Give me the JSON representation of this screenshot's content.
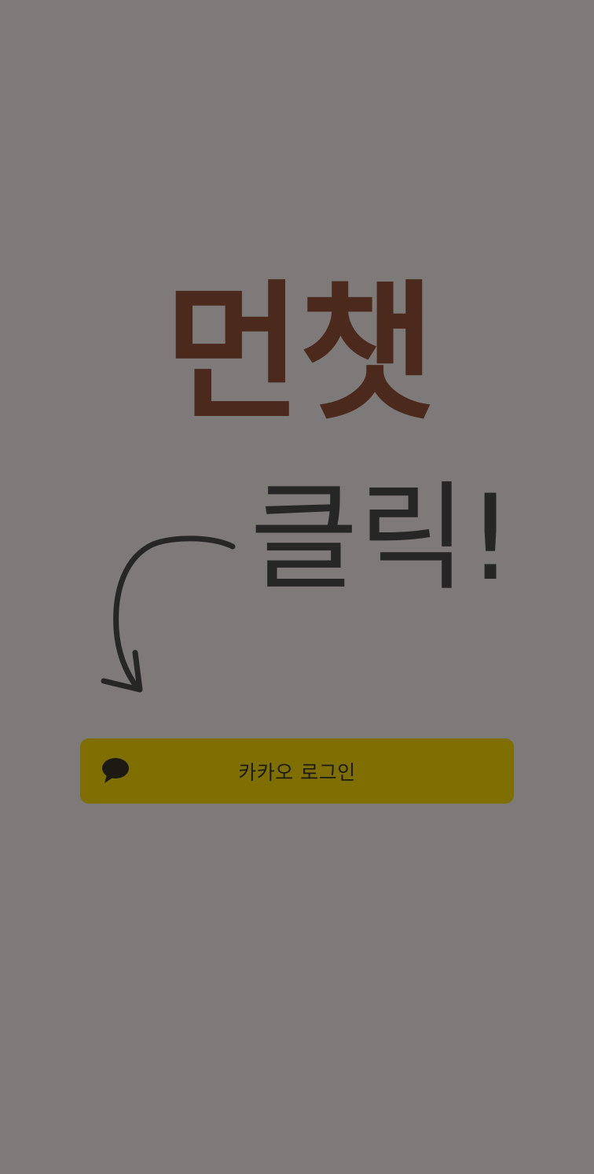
{
  "app": {
    "logo_text": "먼챗"
  },
  "hint": {
    "text": "클릭!",
    "arrow_icon": "curved-arrow-down-icon"
  },
  "login_button": {
    "label": "카카오 로그인",
    "icon": "kakao-speech-bubble-icon",
    "background_color": "#7f6f00"
  },
  "colors": {
    "background": "#7d7a79",
    "logo": "#4b291d",
    "handwriting": "#262626"
  }
}
